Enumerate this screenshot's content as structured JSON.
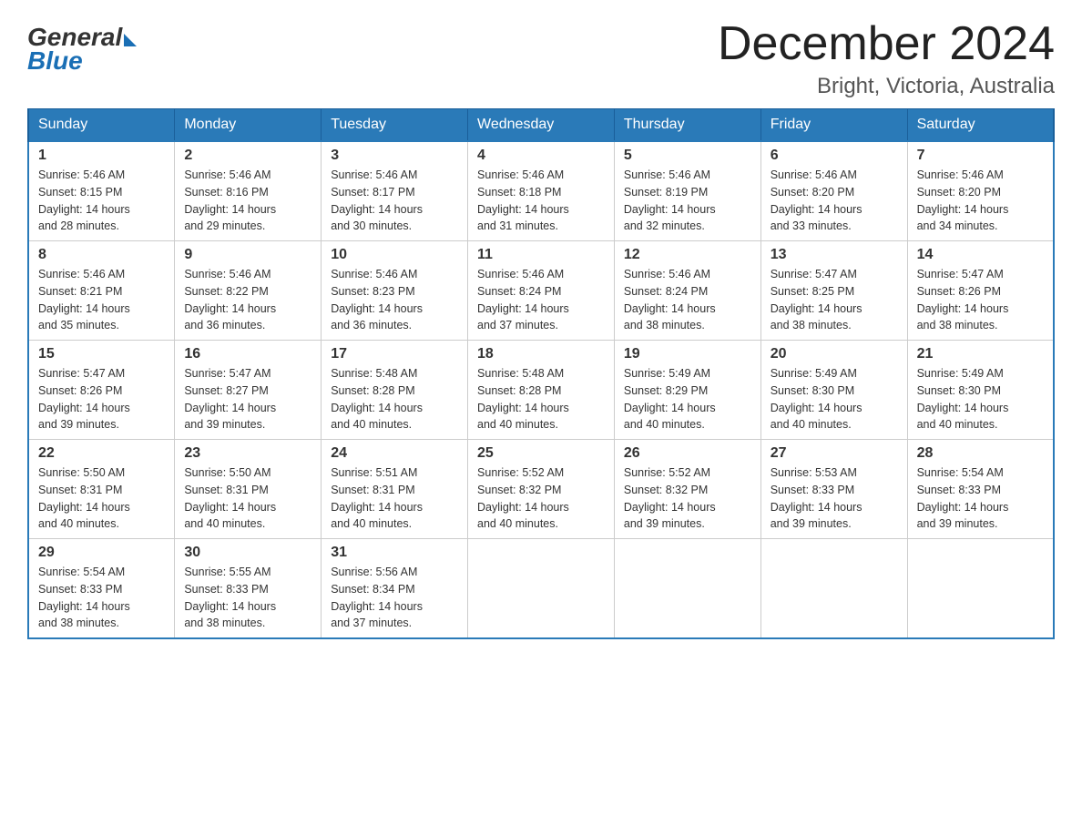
{
  "header": {
    "logo_general": "General",
    "logo_blue": "Blue",
    "month_title": "December 2024",
    "location": "Bright, Victoria, Australia"
  },
  "days_of_week": [
    "Sunday",
    "Monday",
    "Tuesday",
    "Wednesday",
    "Thursday",
    "Friday",
    "Saturday"
  ],
  "weeks": [
    [
      {
        "day": "1",
        "sunrise": "5:46 AM",
        "sunset": "8:15 PM",
        "daylight": "14 hours and 28 minutes."
      },
      {
        "day": "2",
        "sunrise": "5:46 AM",
        "sunset": "8:16 PM",
        "daylight": "14 hours and 29 minutes."
      },
      {
        "day": "3",
        "sunrise": "5:46 AM",
        "sunset": "8:17 PM",
        "daylight": "14 hours and 30 minutes."
      },
      {
        "day": "4",
        "sunrise": "5:46 AM",
        "sunset": "8:18 PM",
        "daylight": "14 hours and 31 minutes."
      },
      {
        "day": "5",
        "sunrise": "5:46 AM",
        "sunset": "8:19 PM",
        "daylight": "14 hours and 32 minutes."
      },
      {
        "day": "6",
        "sunrise": "5:46 AM",
        "sunset": "8:20 PM",
        "daylight": "14 hours and 33 minutes."
      },
      {
        "day": "7",
        "sunrise": "5:46 AM",
        "sunset": "8:20 PM",
        "daylight": "14 hours and 34 minutes."
      }
    ],
    [
      {
        "day": "8",
        "sunrise": "5:46 AM",
        "sunset": "8:21 PM",
        "daylight": "14 hours and 35 minutes."
      },
      {
        "day": "9",
        "sunrise": "5:46 AM",
        "sunset": "8:22 PM",
        "daylight": "14 hours and 36 minutes."
      },
      {
        "day": "10",
        "sunrise": "5:46 AM",
        "sunset": "8:23 PM",
        "daylight": "14 hours and 36 minutes."
      },
      {
        "day": "11",
        "sunrise": "5:46 AM",
        "sunset": "8:24 PM",
        "daylight": "14 hours and 37 minutes."
      },
      {
        "day": "12",
        "sunrise": "5:46 AM",
        "sunset": "8:24 PM",
        "daylight": "14 hours and 38 minutes."
      },
      {
        "day": "13",
        "sunrise": "5:47 AM",
        "sunset": "8:25 PM",
        "daylight": "14 hours and 38 minutes."
      },
      {
        "day": "14",
        "sunrise": "5:47 AM",
        "sunset": "8:26 PM",
        "daylight": "14 hours and 38 minutes."
      }
    ],
    [
      {
        "day": "15",
        "sunrise": "5:47 AM",
        "sunset": "8:26 PM",
        "daylight": "14 hours and 39 minutes."
      },
      {
        "day": "16",
        "sunrise": "5:47 AM",
        "sunset": "8:27 PM",
        "daylight": "14 hours and 39 minutes."
      },
      {
        "day": "17",
        "sunrise": "5:48 AM",
        "sunset": "8:28 PM",
        "daylight": "14 hours and 40 minutes."
      },
      {
        "day": "18",
        "sunrise": "5:48 AM",
        "sunset": "8:28 PM",
        "daylight": "14 hours and 40 minutes."
      },
      {
        "day": "19",
        "sunrise": "5:49 AM",
        "sunset": "8:29 PM",
        "daylight": "14 hours and 40 minutes."
      },
      {
        "day": "20",
        "sunrise": "5:49 AM",
        "sunset": "8:30 PM",
        "daylight": "14 hours and 40 minutes."
      },
      {
        "day": "21",
        "sunrise": "5:49 AM",
        "sunset": "8:30 PM",
        "daylight": "14 hours and 40 minutes."
      }
    ],
    [
      {
        "day": "22",
        "sunrise": "5:50 AM",
        "sunset": "8:31 PM",
        "daylight": "14 hours and 40 minutes."
      },
      {
        "day": "23",
        "sunrise": "5:50 AM",
        "sunset": "8:31 PM",
        "daylight": "14 hours and 40 minutes."
      },
      {
        "day": "24",
        "sunrise": "5:51 AM",
        "sunset": "8:31 PM",
        "daylight": "14 hours and 40 minutes."
      },
      {
        "day": "25",
        "sunrise": "5:52 AM",
        "sunset": "8:32 PM",
        "daylight": "14 hours and 40 minutes."
      },
      {
        "day": "26",
        "sunrise": "5:52 AM",
        "sunset": "8:32 PM",
        "daylight": "14 hours and 39 minutes."
      },
      {
        "day": "27",
        "sunrise": "5:53 AM",
        "sunset": "8:33 PM",
        "daylight": "14 hours and 39 minutes."
      },
      {
        "day": "28",
        "sunrise": "5:54 AM",
        "sunset": "8:33 PM",
        "daylight": "14 hours and 39 minutes."
      }
    ],
    [
      {
        "day": "29",
        "sunrise": "5:54 AM",
        "sunset": "8:33 PM",
        "daylight": "14 hours and 38 minutes."
      },
      {
        "day": "30",
        "sunrise": "5:55 AM",
        "sunset": "8:33 PM",
        "daylight": "14 hours and 38 minutes."
      },
      {
        "day": "31",
        "sunrise": "5:56 AM",
        "sunset": "8:34 PM",
        "daylight": "14 hours and 37 minutes."
      },
      null,
      null,
      null,
      null
    ]
  ],
  "labels": {
    "sunrise": "Sunrise:",
    "sunset": "Sunset:",
    "daylight": "Daylight:"
  }
}
